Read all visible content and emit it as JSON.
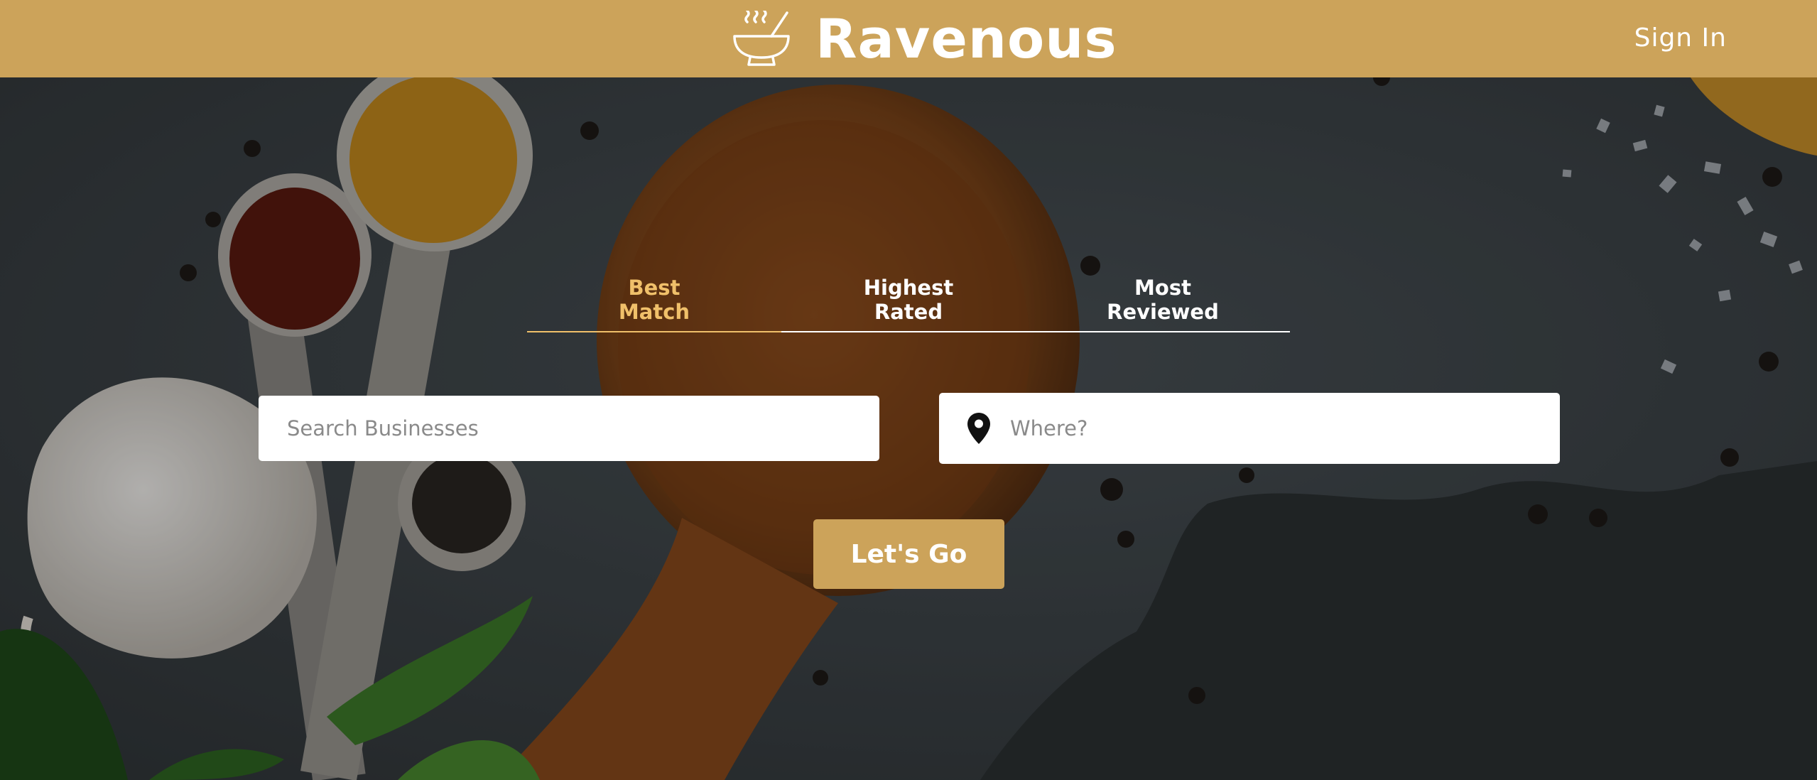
{
  "header": {
    "brand_name": "Ravenous",
    "sign_in_label": "Sign In"
  },
  "sort_tabs": [
    {
      "label_line1": "Best",
      "label_line2": "Match",
      "active": true
    },
    {
      "label_line1": "Highest",
      "label_line2": "Rated",
      "active": false
    },
    {
      "label_line1": "Most",
      "label_line2": "Reviewed",
      "active": false
    }
  ],
  "search": {
    "business_placeholder": "Search Businesses",
    "business_value": "",
    "location_placeholder": "Where?",
    "location_value": ""
  },
  "submit_label": "Let's Go",
  "colors": {
    "brand_gold": "#cca35a",
    "active_tab": "#f0c06a",
    "text_light": "#ffffff"
  },
  "icons": {
    "logo": "steaming-bowl-icon",
    "location": "map-pin-icon"
  }
}
